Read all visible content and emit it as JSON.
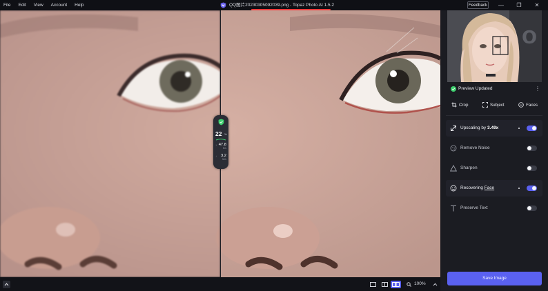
{
  "menu": [
    "File",
    "Edit",
    "View",
    "Account",
    "Help"
  ],
  "window": {
    "title": "QQ图片20230305092039.png - Topaz Photo AI 1.5.2",
    "feedback_label": "Feedback",
    "minimize_glyph": "—",
    "maximize_glyph": "❐",
    "close_glyph": "✕"
  },
  "stats": {
    "percent": "22",
    "percent_symbol": "%",
    "row1_value": "47.8",
    "row1_unit": "K/s",
    "row2_value": "3.2",
    "row2_unit": "M/s"
  },
  "panel": {
    "preview_status": "Preview Updated",
    "tools": [
      {
        "label": "Crop",
        "icon": "crop-icon"
      },
      {
        "label": "Subject",
        "icon": "subject-icon"
      },
      {
        "label": "Faces",
        "icon": "faces-icon"
      }
    ],
    "features": [
      {
        "label_prefix": "Upscaling by ",
        "label_value": "3.49x",
        "enabled": true,
        "icon": "upscale-arrow-icon"
      },
      {
        "label": "Remove Noise",
        "enabled": false,
        "icon": "noise-icon"
      },
      {
        "label": "Sharpen",
        "enabled": false,
        "icon": "sharpen-triangle-icon"
      },
      {
        "label_prefix": "Recovering ",
        "label_value": "Face",
        "enabled": true,
        "icon": "face-smile-icon"
      },
      {
        "label": "Preserve Text",
        "enabled": false,
        "icon": "text-t-icon"
      }
    ],
    "save_label": "Save Image"
  },
  "bottombar": {
    "zoom": "100%"
  },
  "colors": {
    "accent": "#5a61f0",
    "title_underline": "#ff3b3b",
    "success": "#3ecf6e"
  }
}
